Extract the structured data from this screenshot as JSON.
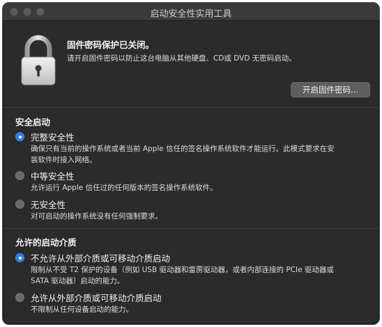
{
  "window": {
    "title": "启动安全性实用工具"
  },
  "firmware": {
    "title": "固件密码保护已关闭。",
    "description": "请开启固件密码以防止这台电脑从其他硬盘、CD或 DVD 无密码启动。",
    "button_label": "开启固件密码..."
  },
  "secure_boot": {
    "title": "安全启动",
    "options": [
      {
        "label": "完整安全性",
        "selected": true,
        "description_lines": [
          "确保只有当前的操作系统或者当前 Apple 信任的签名操作系统软件才能运行。此模式要求在安",
          "装软件时接入网络。"
        ]
      },
      {
        "label": "中等安全性",
        "selected": false,
        "description_lines": [
          "允许运行 Apple 信任过的任何版本的签名操作系统软件。"
        ]
      },
      {
        "label": "无安全性",
        "selected": false,
        "description_lines": [
          "对可启动的操作系统没有任何强制要求。"
        ]
      }
    ]
  },
  "external_boot": {
    "title": "允许的启动介质",
    "options": [
      {
        "label": "不允许从外部介质或可移动介质启动",
        "selected": true,
        "description_lines": [
          "限制从不受 T2 保护的设备（例如 USB 驱动器和雷雳驱动器，或者内部连接的 PCIe 驱动器或",
          "SATA 驱动器）启动的能力。"
        ]
      },
      {
        "label": "允许从外部介质或可移动介质启动",
        "selected": false,
        "description_lines": [
          "不限制从任何设备启动的能力。"
        ]
      }
    ]
  },
  "colors": {
    "accent": "#2f7de1",
    "window_bg": "#2b2b2b",
    "titlebar_bg": "#3a3a3a"
  }
}
